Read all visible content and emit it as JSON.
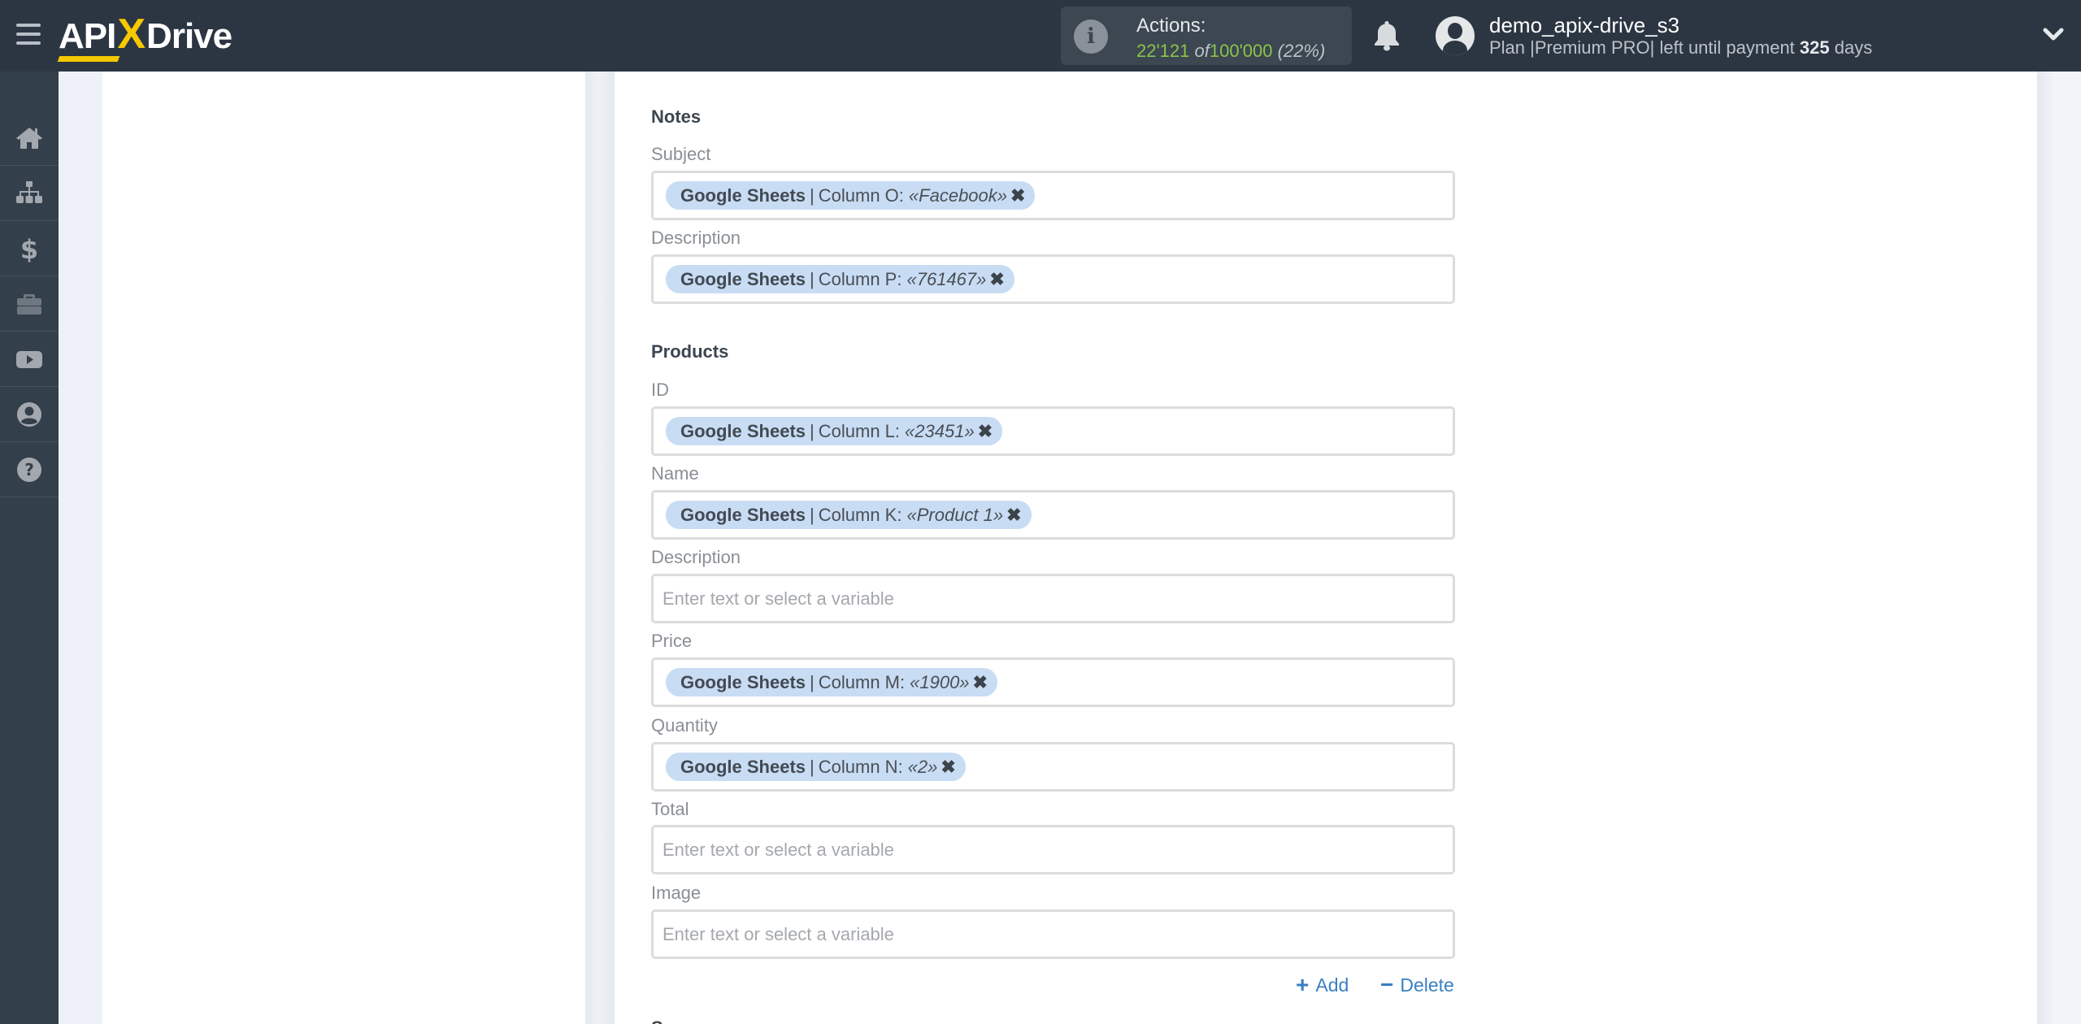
{
  "header": {
    "logo": {
      "api": "API",
      "x": "X",
      "drive": "Drive"
    },
    "actions": {
      "label": "Actions:",
      "used": "22'121",
      "of": "of",
      "total": "100'000",
      "percent": "(22%)"
    },
    "user": {
      "name": "demo_apix-drive_s3",
      "plan_prefix": "Plan |Premium PRO| left until payment",
      "days": "325",
      "days_suffix": "days"
    }
  },
  "sidebar": {
    "items": [
      {
        "name": "home",
        "icon": "home-icon"
      },
      {
        "name": "connections",
        "icon": "sitemap-icon"
      },
      {
        "name": "billing",
        "icon": "dollar-icon"
      },
      {
        "name": "tools",
        "icon": "briefcase-icon"
      },
      {
        "name": "videos",
        "icon": "youtube-icon"
      },
      {
        "name": "account",
        "icon": "user-circle-icon"
      },
      {
        "name": "help",
        "icon": "question-circle-icon"
      }
    ]
  },
  "form": {
    "notes": {
      "title": "Notes",
      "subject": {
        "label": "Subject",
        "chip": {
          "source": "Google Sheets",
          "column": "Column O:",
          "value": "«Facebook»"
        }
      },
      "description": {
        "label": "Description",
        "chip": {
          "source": "Google Sheets",
          "column": "Column P:",
          "value": "«761467»"
        }
      }
    },
    "products": {
      "title": "Products",
      "id": {
        "label": "ID",
        "chip": {
          "source": "Google Sheets",
          "column": "Column L:",
          "value": "«23451»"
        }
      },
      "name": {
        "label": "Name",
        "chip": {
          "source": "Google Sheets",
          "column": "Column K:",
          "value": "«Product 1»"
        }
      },
      "description": {
        "label": "Description",
        "placeholder": "Enter text or select a variable"
      },
      "price": {
        "label": "Price",
        "chip": {
          "source": "Google Sheets",
          "column": "Column M:",
          "value": "«1900»"
        }
      },
      "quantity": {
        "label": "Quantity",
        "chip": {
          "source": "Google Sheets",
          "column": "Column N:",
          "value": "«2»"
        }
      },
      "total": {
        "label": "Total",
        "placeholder": "Enter text or select a variable"
      },
      "image": {
        "label": "Image",
        "placeholder": "Enter text or select a variable"
      }
    },
    "add_label": "Add",
    "delete_label": "Delete",
    "chip_separator": "|",
    "chip_remove": "✖",
    "next_section_title": "S"
  },
  "colors": {
    "header_bg": "#2c3642",
    "sidebar_bg": "#343f4c",
    "accent_yellow": "#f5c800",
    "actions_green": "#8bc34a",
    "chip_bg": "#c8dcf4",
    "link_blue": "#3a7fc1"
  }
}
